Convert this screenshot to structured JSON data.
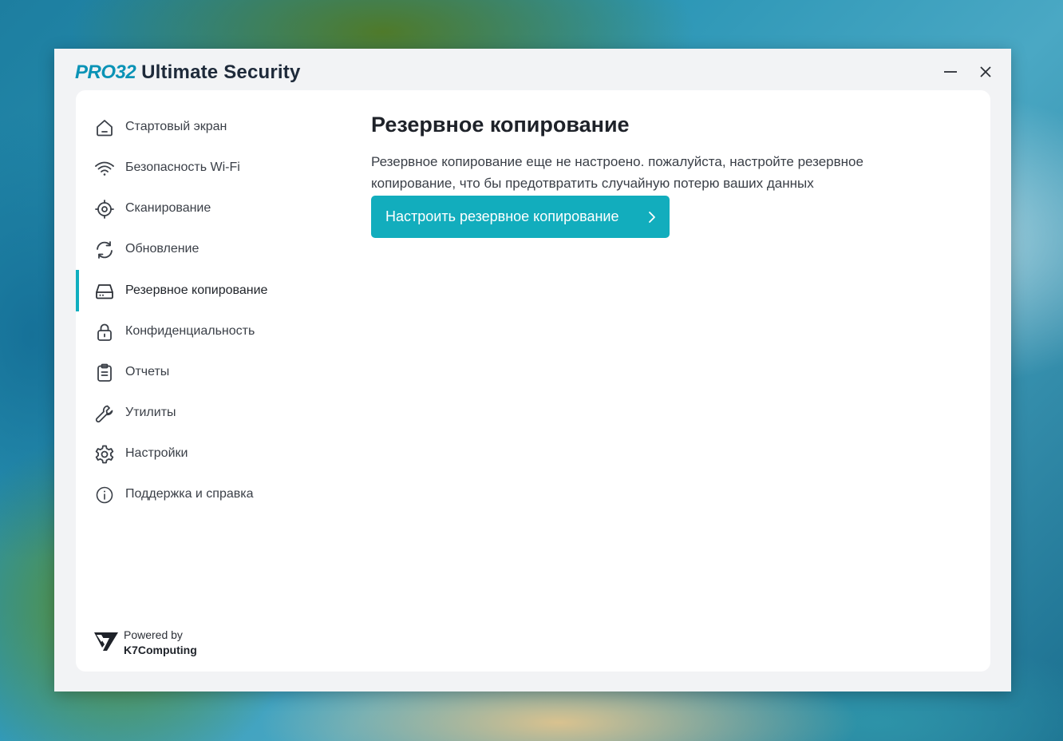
{
  "window": {
    "title_brand": "PRO32",
    "title_rest": " Ultimate Security"
  },
  "sidebar": {
    "items": [
      {
        "id": "home",
        "label": "Стартовый экран",
        "icon": "home-icon"
      },
      {
        "id": "wifi",
        "label": "Безопасность Wi-Fi",
        "icon": "wifi-icon"
      },
      {
        "id": "scan",
        "label": "Сканирование",
        "icon": "scan-target-icon"
      },
      {
        "id": "update",
        "label": "Обновление",
        "icon": "refresh-icon"
      },
      {
        "id": "backup",
        "label": "Резервное копирование",
        "icon": "hard-drive-icon",
        "active": true
      },
      {
        "id": "privacy",
        "label": "Конфиденциальность",
        "icon": "lock-icon"
      },
      {
        "id": "reports",
        "label": "Отчеты",
        "icon": "clipboard-icon"
      },
      {
        "id": "utilities",
        "label": "Утилиты",
        "icon": "wrench-icon"
      },
      {
        "id": "settings",
        "label": "Настройки",
        "icon": "gear-icon"
      },
      {
        "id": "support",
        "label": "Поддержка и справка",
        "icon": "info-icon"
      }
    ],
    "powered_by": "Powered by",
    "vendor": "K7Computing"
  },
  "main": {
    "title": "Резервное копирование",
    "description": "Резервное копирование еще не настроено. пожалуйста, настройте резервное копирование, что бы предотвратить случайную потерю ваших данных",
    "button_label": "Настроить резервное копирование"
  },
  "colors": {
    "accent": "#12adbd",
    "brand": "#0b93b6",
    "text": "#1e2229"
  }
}
